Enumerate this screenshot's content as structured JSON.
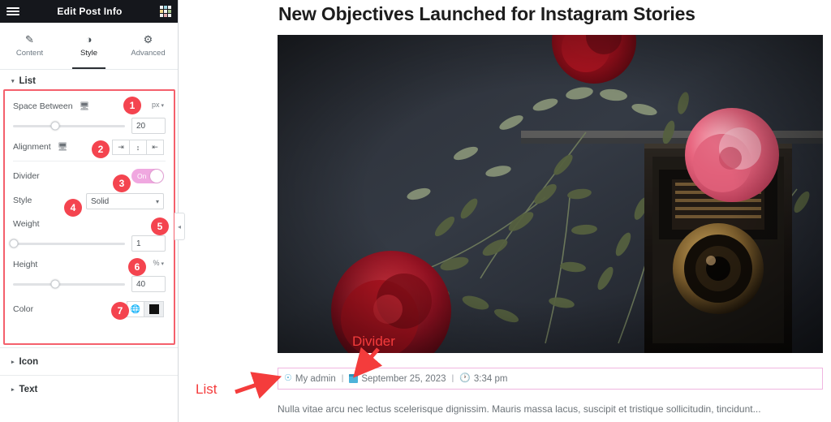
{
  "panel": {
    "header": {
      "title": "Edit Post Info",
      "menu_icon": "hamburger-menu-icon",
      "apps_icon": "apps-grid-icon"
    },
    "tabs": [
      {
        "label": "Content",
        "icon": "pencil-icon",
        "active": false
      },
      {
        "label": "Style",
        "icon": "contrast-icon",
        "active": true
      },
      {
        "label": "Advanced",
        "icon": "gear-icon",
        "active": false
      }
    ],
    "section": {
      "label": "List",
      "caret": "▾"
    },
    "controls": {
      "space_between": {
        "label": "Space Between",
        "device_icon": "desktop-icon",
        "unit": "px",
        "value": "20",
        "knob_percent": 38
      },
      "alignment": {
        "label": "Alignment",
        "device_icon": "desktop-icon",
        "options": [
          {
            "name": "align-left",
            "glyph": "⇥"
          },
          {
            "name": "align-center",
            "glyph": "↕"
          },
          {
            "name": "align-right",
            "glyph": "⇤"
          }
        ]
      },
      "divider": {
        "label": "Divider",
        "toggle_state": "On"
      },
      "style": {
        "label": "Style",
        "value": "Solid",
        "caret": "▾"
      },
      "weight": {
        "label": "Weight",
        "value": "1",
        "knob_percent": 1
      },
      "height": {
        "label": "Height",
        "unit": "%",
        "value": "40",
        "knob_percent": 38
      },
      "color": {
        "label": "Color",
        "global_icon": "globe-icon",
        "swatch_hex": "#121212"
      }
    },
    "accordions": [
      {
        "label": "Icon",
        "caret": "▸"
      },
      {
        "label": "Text",
        "caret": "▸"
      }
    ],
    "collapse_handle": "◂",
    "badges": [
      "1",
      "2",
      "3",
      "4",
      "5",
      "6",
      "7"
    ]
  },
  "content": {
    "post_title": "New Objectives Launched for Instagram Stories",
    "featured_image_alt": "vintage-camera-with-roses-photo",
    "meta": {
      "author": {
        "icon": "user-circle-icon",
        "text": "My admin"
      },
      "date": {
        "icon": "calendar-icon",
        "text": "September 25, 2023"
      },
      "time": {
        "icon": "clock-icon",
        "text": "3:34 pm"
      },
      "separator": "|"
    },
    "excerpt": "Nulla vitae arcu nec lectus scelerisque dignissim. Mauris massa lacus, suscipit et tristique sollicitudin, tincidunt..."
  },
  "annotations": {
    "divider_label": "Divider",
    "list_label": "List",
    "accent_color": "#f43c3c",
    "highlight_border": "#f4606c",
    "meta_outline": "#f0b6e0"
  }
}
